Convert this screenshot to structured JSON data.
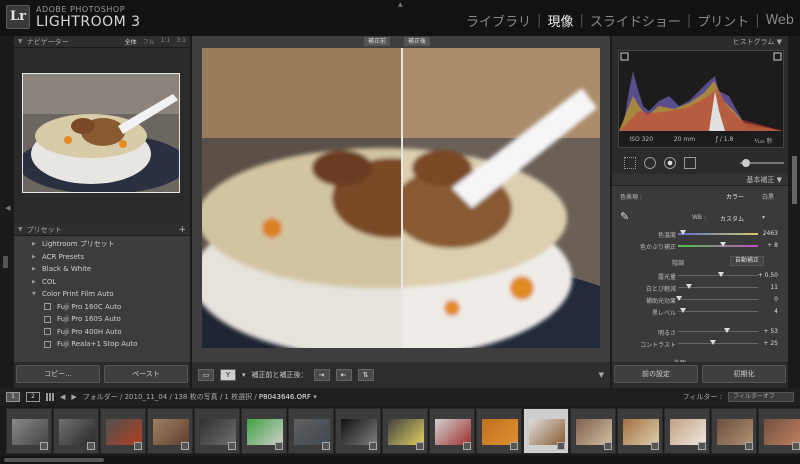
{
  "app": {
    "brand_small": "ADOBE PHOTOSHOP",
    "brand_big": "LIGHTROOM 3",
    "logo": "Lr",
    "modules": [
      {
        "label": "ライブラリ",
        "active": false
      },
      {
        "label": "現像",
        "active": true
      },
      {
        "label": "スライドショー",
        "active": false
      },
      {
        "label": "プリント",
        "active": false
      },
      {
        "label": "Web",
        "active": false
      }
    ]
  },
  "navigator": {
    "title": "ナビゲーター",
    "options": [
      "全体",
      "フル",
      "1:1",
      "3:1"
    ]
  },
  "presets": {
    "title": "プリセット",
    "items": [
      {
        "label": "Lightroom プリセット",
        "level": 0
      },
      {
        "label": "ACR Presets",
        "level": 0
      },
      {
        "label": "Black & White",
        "level": 0
      },
      {
        "label": "COL",
        "level": 0
      },
      {
        "label": "Color Print Film Auto",
        "level": 0,
        "open": true
      },
      {
        "label": "Fuji Pro 160C Auto",
        "level": 1
      },
      {
        "label": "Fuji Pro 160S Auto",
        "level": 1
      },
      {
        "label": "Fuji Pro 400H Auto",
        "level": 1
      },
      {
        "label": "Fuji Reala+1 Stop Auto",
        "level": 1
      }
    ],
    "copy_button": "コピー...",
    "paste_button": "ペースト"
  },
  "compare": {
    "before_label": "補正前",
    "after_label": "補正後",
    "toolbar_text": "補正前と補正後："
  },
  "histogram": {
    "title": "ヒストグラム",
    "iso": "ISO 320",
    "focal": "20 mm",
    "aperture": "ƒ / 1.8",
    "shutter": "¹⁄₁₂₅ 秒"
  },
  "basic": {
    "title": "基本補正",
    "treatment_label": "色表現 :",
    "color_option": "カラー",
    "bw_option": "白黒",
    "wb_label": "WB :",
    "wb_value": "カスタム",
    "temp_label": "色温度",
    "temp_value": "2463",
    "tint_label": "色かぶり補正",
    "tint_value": "+ 8",
    "tone_label": "階調",
    "auto_label": "自動補正",
    "exposure_label": "露光量",
    "exposure_value": "+ 0.50",
    "recovery_label": "白とび軽減",
    "recovery_value": "11",
    "fill_label": "補助光効果",
    "fill_value": "0",
    "blacks_label": "黒レベル",
    "blacks_value": "4",
    "brightness_label": "明るさ",
    "brightness_value": "+ 53",
    "contrast_label": "コントラスト",
    "contrast_value": "+ 25",
    "presence_label": "外観",
    "prev_button": "前の設定",
    "reset_button": "初期化"
  },
  "filmstrip": {
    "monitor1": "1",
    "monitor2": "2",
    "path_prefix": "フォルダー / 2010_11_04 / 138 枚の写真 / 1 枚選択 /",
    "current_file": "P8043646.ORF",
    "filter_label": "フィルター :",
    "filter_value": "フィルターオフ",
    "selected_index": 11,
    "thumb_count": 17
  }
}
